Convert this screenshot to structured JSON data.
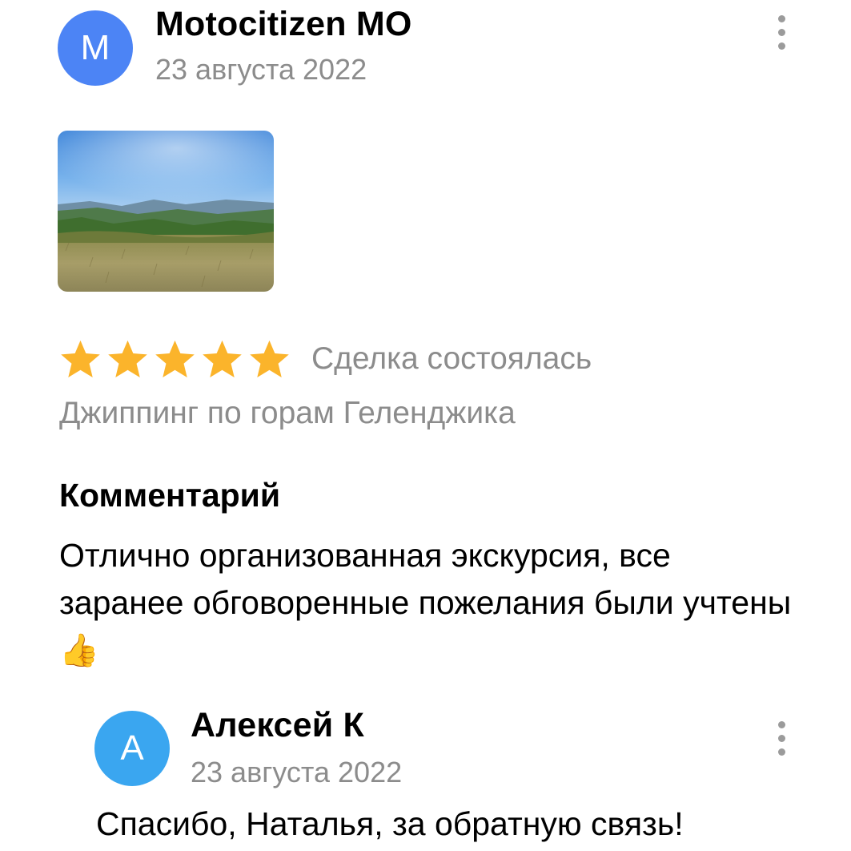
{
  "review": {
    "author": {
      "initial": "M",
      "name": "Motocitizen MO",
      "date": "23 августа 2022",
      "avatar_color": "#4c84f5"
    },
    "photo": {
      "icon": "landscape-photo"
    },
    "rating": {
      "stars": 5,
      "max_stars": 5,
      "star_color": "#fbb42b"
    },
    "deal_status": "Сделка состоялась",
    "listing_title": "Джиппинг по горам Геленджика",
    "comment_heading": "Комментарий",
    "comment_text": "Отлично организованная экскурсия, все заранее обговоренные пожелания были учтены",
    "comment_emoji": "👍"
  },
  "reply": {
    "author": {
      "initial": "А",
      "name": "Алексей К",
      "date": "23 августа 2022",
      "avatar_color": "#3aa6f0"
    },
    "text": "Спасибо, Наталья, за обратную связь!"
  },
  "icons": {
    "more_menu": "more-vertical-icon"
  },
  "colors": {
    "secondary_text": "#8c8c8c",
    "menu_dots": "#9b9b9b"
  }
}
